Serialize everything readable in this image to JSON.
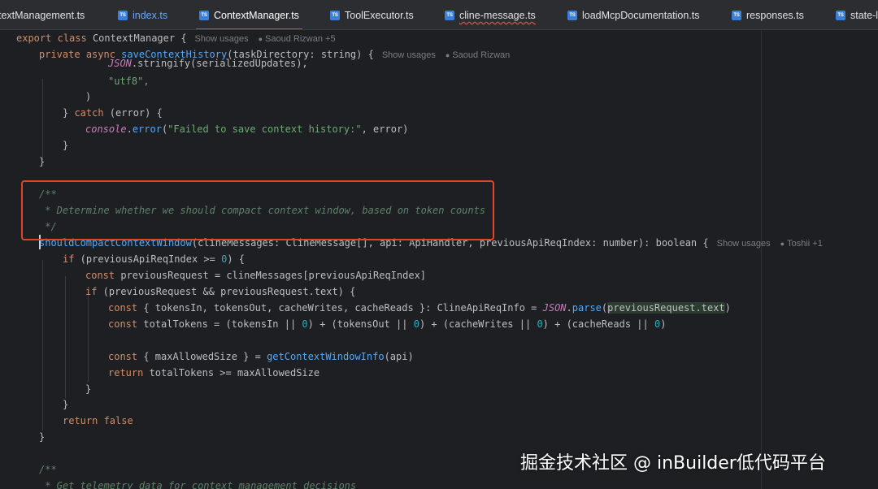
{
  "tabs": [
    {
      "label": "textManagement.ts",
      "icon": "typescript-file-icon",
      "active": false
    },
    {
      "label": "index.ts",
      "icon": "typescript-file-icon",
      "active": false
    },
    {
      "label": "ContextManager.ts",
      "icon": "typescript-file-icon",
      "active": true
    },
    {
      "label": "ToolExecutor.ts",
      "icon": "typescript-file-icon",
      "active": false
    },
    {
      "label": "cline-message.ts",
      "icon": "typescript-file-icon",
      "active": false
    },
    {
      "label": "loadMcpDocumentation.ts",
      "icon": "typescript-file-icon",
      "active": false
    },
    {
      "label": "responses.ts",
      "icon": "typescript-file-icon",
      "active": false
    },
    {
      "label": "state-l",
      "icon": "typescript-file-icon",
      "active": false
    }
  ],
  "ts_icon_text": "TS",
  "hints": {
    "show_usages": "Show usages",
    "class_author": "Saoud Rizwan +5",
    "method_author": "Saoud Rizwan",
    "fn_author": "Toshii +1"
  },
  "code": {
    "l1_export": "export",
    "l1_class": "class",
    "l1_name": "ContextManager {",
    "l2_private": "private",
    "l2_async": "async",
    "l2_fn": "saveContextHistory",
    "l2_params": "(taskDirectory: string) {",
    "l3_json": "JSON",
    "l3_rest": ".stringify(serializedUpdates),",
    "l4_str": "\"utf8\",",
    "l5": ")",
    "l6_brace": "} ",
    "l6_catch": "catch",
    "l6_rest": " (error) {",
    "l7_console": "console",
    "l7_dot": ".",
    "l7_fn": "error",
    "l7_open": "(",
    "l7_str": "\"Failed to save context history:\"",
    "l7_rest": ", error)",
    "l8": "}",
    "l9": "}",
    "doc_open": "/**",
    "doc_text": " * Determine whether we should compact context window, based on token counts",
    "doc_close": " */",
    "sig_fn": "shouldCompactContextWindow",
    "sig_params": "(clineMessages: ClineMessage[], api: ApiHandler, previousApiReqIndex: number): boolean {",
    "if1_kw": "if",
    "if1_a": " (previousApiReqIndex >= ",
    "if1_num": "0",
    "if1_b": ") {",
    "c1_kw": "const",
    "c1_rest": " previousRequest = clineMessages[previousApiReqIndex]",
    "if2_kw": "if",
    "if2_rest": " (previousRequest && previousRequest.text) {",
    "c2_kw": "const",
    "c2_a": " { tokensIn, tokensOut, cacheWrites, cacheReads }: ClineApiReqInfo = ",
    "c2_json": "JSON",
    "c2_dot": ".",
    "c2_parse": "parse",
    "c2_open": "(",
    "c2_arg": "previousRequest.text",
    "c2_close": ")",
    "c3_kw": "const",
    "c3_a": " totalTokens = (tokensIn || ",
    "c3_n1": "0",
    "c3_b": ") + (tokensOut || ",
    "c3_n2": "0",
    "c3_c": ") + (cacheWrites || ",
    "c3_n3": "0",
    "c3_d": ") + (cacheReads || ",
    "c3_n4": "0",
    "c3_e": ")",
    "c4_kw": "const",
    "c4_a": " { maxAllowedSize } = ",
    "c4_fn": "getContextWindowInfo",
    "c4_b": "(api)",
    "r1_kw": "return",
    "r1_rest": " totalTokens >= maxAllowedSize",
    "b1": "}",
    "b2": "}",
    "r2_kw": "return",
    "r2_false": " false",
    "b3": "}",
    "doc2_open": "/**",
    "doc2_text": " * Get telemetry data for context management decisions"
  },
  "watermark": "掘金技术社区 @ inBuilder低代码平台",
  "colors": {
    "background": "#1e1f22",
    "tabbar": "#2b2d30",
    "keyword": "#cf8e6d",
    "function": "#56a8f5",
    "string": "#6aab73",
    "number": "#2aacb8",
    "doc_comment": "#5f826b",
    "annotation_box": "#e2442a",
    "active_tab_underline": "#3574f0"
  }
}
